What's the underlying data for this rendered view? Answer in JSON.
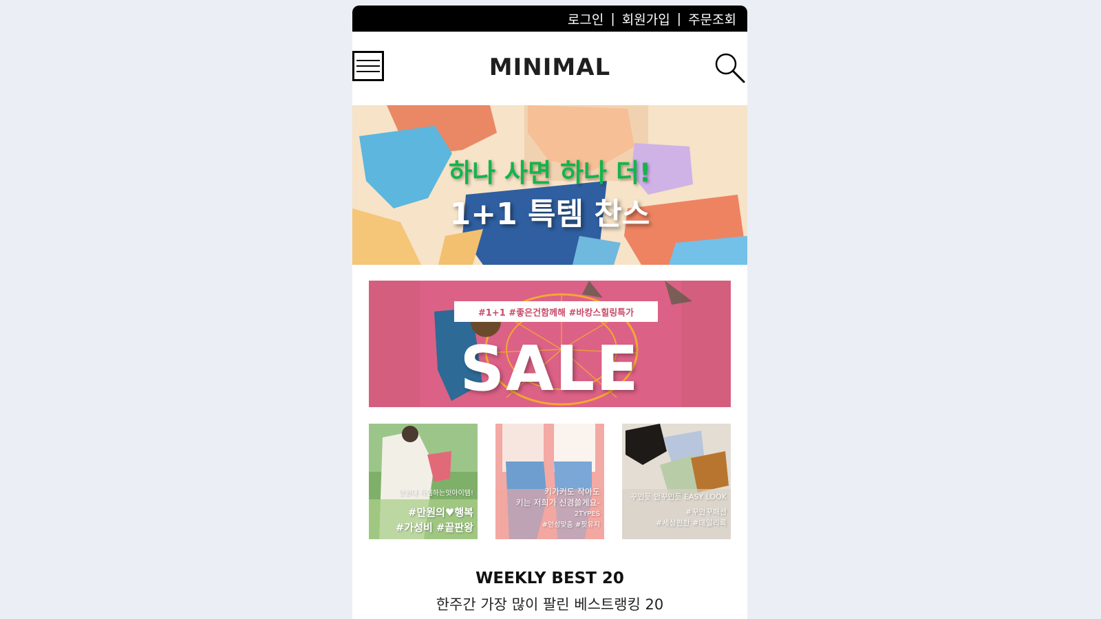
{
  "topbar": {
    "login": "로그인",
    "signup": "회원가입",
    "order_lookup": "주문조회",
    "separator": "|"
  },
  "header": {
    "logo": "MINIMAL",
    "menu_icon": "hamburger-menu-icon",
    "search_icon": "search-icon"
  },
  "hero": {
    "line1": "하나 사면 하나 더!",
    "line2": "1+1 특템 찬스",
    "colors": {
      "background": "#f6e3c8",
      "headline_green": "#12b54a"
    }
  },
  "sale_banner": {
    "tags": "#1+1  #좋은건함께해  #바캉스힐링특가",
    "word": "SALE",
    "background": "#d45e7d"
  },
  "thumbnails": [
    {
      "caption_small": "만원대 득템하는잇아이템!",
      "caption_big_1": "#만원의♥행복",
      "caption_big_2": "#가성비 #끝판왕"
    },
    {
      "caption_small_1": "키가커도 작아도",
      "caption_small_2": "키는 저희가 신경쓸게요-",
      "caption_small_3": "2TYPES",
      "caption_small_4": "#안성맞춤 #핏유지"
    },
    {
      "caption_small_1": "꾸민듯 안꾸민듯 EASY LOOK",
      "caption_small_2": "#꾸안꾸패션",
      "caption_small_3": "#세상편한 #데일리룩"
    }
  ],
  "weekly_best": {
    "title": "WEEKLY BEST 20",
    "subtitle": "한주간 가장 많이 팔린 베스트랭킹 20"
  }
}
